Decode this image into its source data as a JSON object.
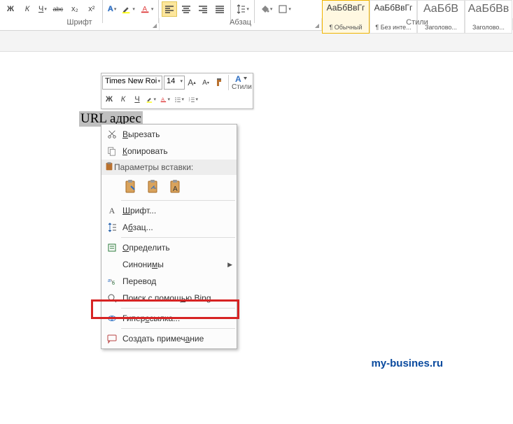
{
  "groups": {
    "font_label": "Шрифт",
    "para_label": "Абзац",
    "styles_label": "Стили"
  },
  "ribbon": {
    "bold": "Ж",
    "italic": "К",
    "underline": "Ч",
    "strike": "abc",
    "sub": "x₂",
    "sup": "x²"
  },
  "styles": {
    "s0": {
      "preview": "АаБбВвГг",
      "label": "¶ Обычный"
    },
    "s1": {
      "preview": "АаБбВвГг",
      "label": "¶ Без инте..."
    },
    "s2": {
      "preview": "АаБбВ",
      "label": "Заголово..."
    },
    "s3": {
      "preview": "АаБбВв",
      "label": "Заголово..."
    }
  },
  "mini": {
    "font_name": "Times New Roi",
    "font_size": "14",
    "styles_label": "Стили"
  },
  "selection_text": "URL адрес",
  "menu": {
    "cut": "Вырезать",
    "copy": "Копировать",
    "paste_header": "Параметры вставки:",
    "font": "Шрифт...",
    "para": "Абзац...",
    "define": "Определить",
    "synonyms": "Синонимы",
    "translate": "Перевод",
    "search_bing": "Поиск с помощью Bing",
    "hyperlink": "Гиперссылка...",
    "comment": "Создать примечание"
  },
  "watermark": "my-busines.ru",
  "colors": {
    "highlight_red": "#d72323",
    "link_blue": "#0a4a9e"
  }
}
